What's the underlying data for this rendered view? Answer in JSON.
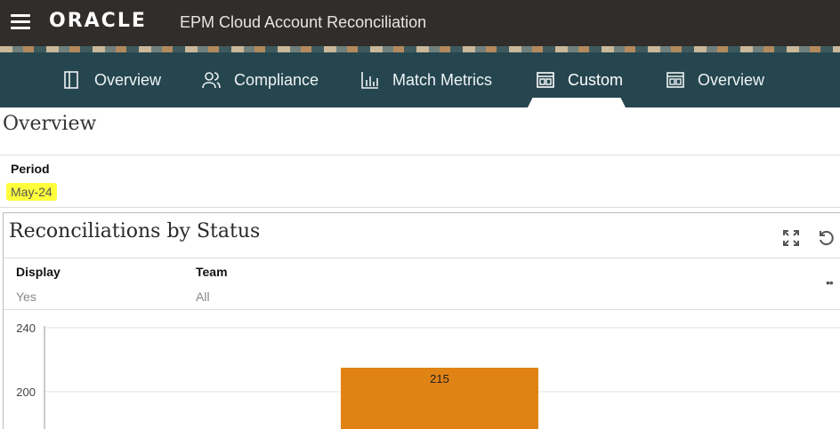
{
  "header": {
    "logo_text": "ORACLE",
    "app_title": "EPM Cloud Account Reconciliation"
  },
  "nav": {
    "tabs": [
      {
        "label": "Overview",
        "icon": "panel-layout-icon",
        "active": false
      },
      {
        "label": "Compliance",
        "icon": "users-icon",
        "active": false
      },
      {
        "label": "Match Metrics",
        "icon": "bar-chart-icon",
        "active": false
      },
      {
        "label": "Custom",
        "icon": "dashboard-icon",
        "active": true
      },
      {
        "label": "Overview",
        "icon": "dashboard-icon",
        "active": false
      }
    ]
  },
  "page": {
    "title": "Overview",
    "period_label": "Period",
    "period_value": "May-24"
  },
  "panel": {
    "title": "Reconciliations by Status",
    "filters": [
      {
        "label": "Display",
        "value": "Yes"
      },
      {
        "label": "Team",
        "value": "All"
      }
    ],
    "more_label": "••"
  },
  "colors": {
    "topbar": "#312d2a",
    "navbar": "#26464f",
    "bar": "#e08214",
    "highlight": "#ffff3c"
  },
  "chart_data": {
    "type": "bar",
    "title": "",
    "categories": [
      ""
    ],
    "values": [
      215
    ],
    "data_labels": [
      "215"
    ],
    "y_ticks": [
      200,
      240
    ],
    "ylim": [
      180,
      240
    ],
    "grid": true
  }
}
